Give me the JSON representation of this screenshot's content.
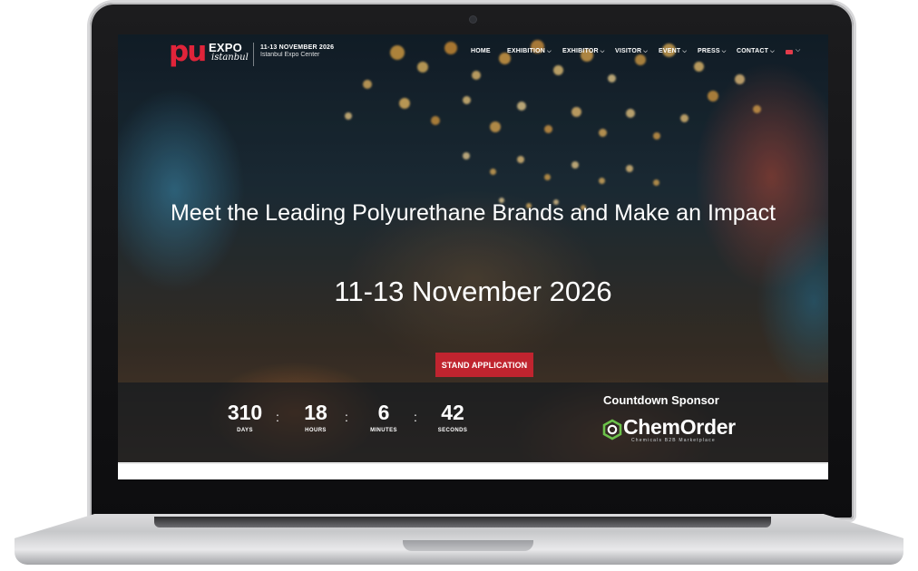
{
  "nav": {
    "logo_pu": "pu",
    "logo_expo": "EXPO",
    "logo_istanbul": "istanbul",
    "event_dates": "11-13 NOVEMBER 2026",
    "venue": "Istanbul Expo Center",
    "menu": [
      {
        "label": "HOME",
        "has_dropdown": false
      },
      {
        "label": "EXHIBITION",
        "has_dropdown": true
      },
      {
        "label": "EXHIBITOR",
        "has_dropdown": true
      },
      {
        "label": "VISITOR",
        "has_dropdown": true
      },
      {
        "label": "EVENT",
        "has_dropdown": true
      },
      {
        "label": "PRESS",
        "has_dropdown": true
      },
      {
        "label": "CONTACT",
        "has_dropdown": true
      }
    ],
    "language_flag": "flag-icon"
  },
  "hero": {
    "headline": "Meet the Leading Polyurethane Brands and Make an Impact",
    "dates": "11-13 November 2026",
    "cta_label": "STAND APPLICATION"
  },
  "countdown": {
    "units": [
      {
        "value": "310",
        "label": "DAYS"
      },
      {
        "value": "18",
        "label": "HOURS"
      },
      {
        "value": "6",
        "label": "MINUTES"
      },
      {
        "value": "42",
        "label": "SECONDS"
      }
    ],
    "separator": ":"
  },
  "sponsor": {
    "title": "Countdown Sponsor",
    "name": "ChemOrder",
    "tagline": "Chemicals B2B Marketplace"
  },
  "colors": {
    "accent_red": "#c0242f",
    "logo_red": "#e0243a",
    "sponsor_green": "#6cc24a"
  }
}
